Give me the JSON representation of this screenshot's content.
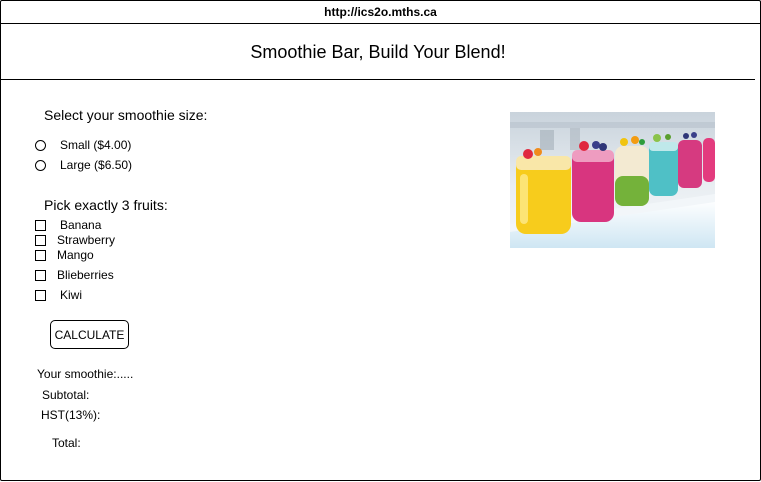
{
  "browser": {
    "url": "http://ics2o.mths.ca"
  },
  "page": {
    "title": "Smoothie Bar, Build Your Blend!"
  },
  "size_section": {
    "heading": "Select your smoothie size:",
    "options": [
      {
        "label": "Small ($4.00)",
        "selected": false
      },
      {
        "label": "Large ($6.50)",
        "selected": false
      }
    ]
  },
  "fruit_section": {
    "heading": "Pick exactly 3 fruits:",
    "options": [
      {
        "label": "Banana",
        "checked": false
      },
      {
        "label": "Strawberry",
        "checked": false
      },
      {
        "label": "Mango",
        "checked": false
      },
      {
        "label": "Blieberries",
        "checked": false
      },
      {
        "label": "Kiwi",
        "checked": false
      }
    ]
  },
  "calculate_button": {
    "label": "CALCULATE"
  },
  "results": {
    "smoothie": "Your smoothie:.....",
    "subtotal": "Subtotal:",
    "hst": "HST(13%):",
    "total": "Total:"
  },
  "image": {
    "subject": "row of colorful smoothie jars"
  },
  "colors": {
    "border": "#000000",
    "background": "#ffffff"
  }
}
